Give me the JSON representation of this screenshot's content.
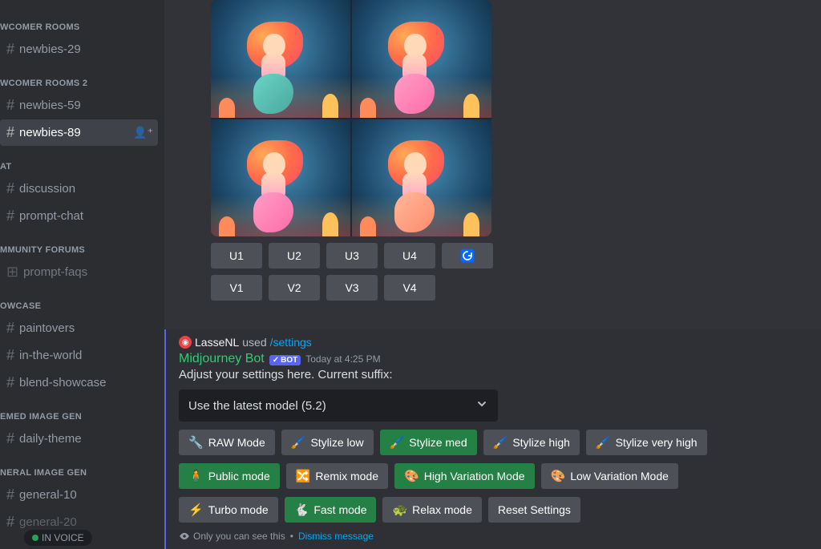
{
  "sidebar": {
    "sections": [
      {
        "header": "WCOMER ROOMS",
        "items": [
          {
            "label": "newbies-29",
            "active": false
          }
        ]
      },
      {
        "header": "WCOMER ROOMS 2",
        "items": [
          {
            "label": "newbies-59",
            "active": false
          },
          {
            "label": "newbies-89",
            "active": true
          }
        ]
      },
      {
        "header": "AT",
        "items": [
          {
            "label": "discussion",
            "active": false
          },
          {
            "label": "prompt-chat",
            "active": false
          }
        ]
      },
      {
        "header": "MMUNITY FORUMS",
        "items": [
          {
            "label": "prompt-faqs",
            "active": false,
            "faq": true
          }
        ]
      },
      {
        "header": "OWCASE",
        "items": [
          {
            "label": "paintovers",
            "active": false
          },
          {
            "label": "in-the-world",
            "active": false
          },
          {
            "label": "blend-showcase",
            "active": false
          }
        ]
      },
      {
        "header": "EMED IMAGE GEN",
        "items": [
          {
            "label": "daily-theme",
            "active": false
          }
        ]
      },
      {
        "header": "NERAL IMAGE GEN",
        "items": [
          {
            "label": "general-10",
            "active": false
          },
          {
            "label": "general-20",
            "active": false,
            "cut": true
          }
        ]
      }
    ]
  },
  "upscale_buttons": [
    "U1",
    "U2",
    "U3",
    "U4"
  ],
  "variation_buttons": [
    "V1",
    "V2",
    "V3",
    "V4"
  ],
  "command": {
    "user": "LasseNL",
    "used_label": "used",
    "command": "/settings"
  },
  "bot": {
    "name": "Midjourney Bot",
    "tag_check": "✓",
    "tag_text": "BOT",
    "timestamp": "Today at 4:25 PM",
    "settings_text": "Adjust your settings here. Current suffix:"
  },
  "model_select": {
    "label": "Use the latest model (5.2)"
  },
  "settings_rows": [
    [
      {
        "emoji": "🔧",
        "label": "RAW Mode",
        "green": false
      },
      {
        "emoji": "🖌️",
        "label": "Stylize low",
        "green": false
      },
      {
        "emoji": "🖌️",
        "label": "Stylize med",
        "green": true
      },
      {
        "emoji": "🖌️",
        "label": "Stylize high",
        "green": false
      },
      {
        "emoji": "🖌️",
        "label": "Stylize very high",
        "green": false
      }
    ],
    [
      {
        "emoji": "🧍",
        "label": "Public mode",
        "green": true
      },
      {
        "emoji": "🔀",
        "label": "Remix mode",
        "green": false
      },
      {
        "emoji": "🎨",
        "label": "High Variation Mode",
        "green": true
      },
      {
        "emoji": "🎨",
        "label": "Low Variation Mode",
        "green": false
      }
    ],
    [
      {
        "emoji": "⚡",
        "label": "Turbo mode",
        "green": false
      },
      {
        "emoji": "🐇",
        "label": "Fast mode",
        "green": true
      },
      {
        "emoji": "🐢",
        "label": "Relax mode",
        "green": false
      },
      {
        "emoji": "",
        "label": "Reset Settings",
        "green": false
      }
    ]
  ],
  "ephemeral": {
    "text": "Only you can see this",
    "dismiss": "Dismiss message"
  },
  "voice": {
    "label": "IN VOICE"
  }
}
